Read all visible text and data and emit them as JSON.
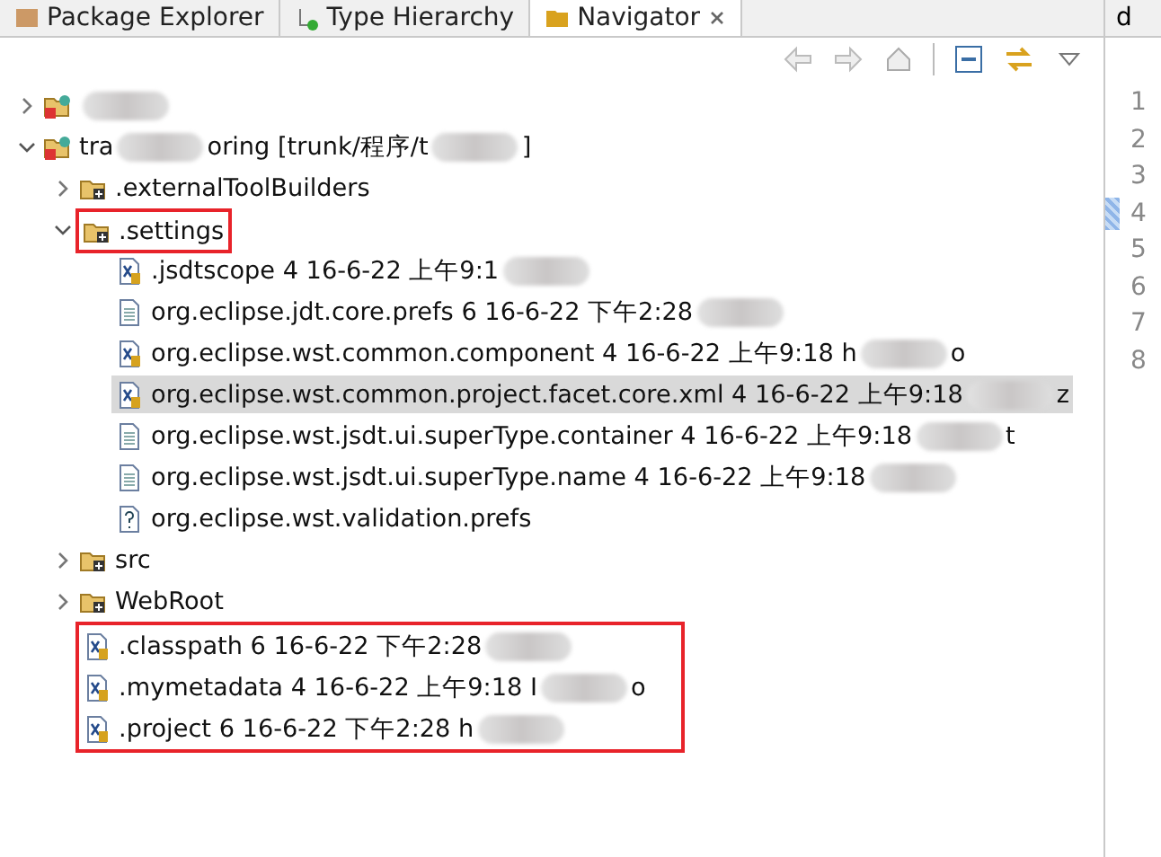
{
  "tabs": [
    {
      "label": "Package Explorer",
      "kind": "package",
      "selected": false
    },
    {
      "label": "Type Hierarchy",
      "kind": "hierarchy",
      "selected": false
    },
    {
      "label": "Navigator",
      "kind": "navigator",
      "selected": true
    }
  ],
  "tree": [
    {
      "kind": "project",
      "expanded": false,
      "selected": false,
      "highlighted": false,
      "segments": [
        {
          "kind": "blur"
        }
      ]
    },
    {
      "kind": "project",
      "expanded": true,
      "selected": false,
      "highlighted": false,
      "segments": [
        {
          "kind": "text",
          "text": "tra"
        },
        {
          "kind": "blur"
        },
        {
          "kind": "text",
          "text": "oring [trunk/程序/t"
        },
        {
          "kind": "blur"
        },
        {
          "kind": "text",
          "text": "]"
        }
      ],
      "children": [
        {
          "kind": "folder",
          "expanded": false,
          "selected": false,
          "highlighted": false,
          "segments": [
            {
              "kind": "text",
              "text": ".externalToolBuilders"
            }
          ]
        },
        {
          "kind": "folder",
          "expanded": true,
          "selected": false,
          "highlighted": true,
          "segments": [
            {
              "kind": "text",
              "text": ".settings"
            }
          ],
          "children": [
            {
              "kind": "xfile",
              "selected": false,
              "highlighted": false,
              "segments": [
                {
                  "kind": "text",
                  "text": ".jsdtscope 4  16-6-22 上午9:1"
                },
                {
                  "kind": "blur"
                }
              ]
            },
            {
              "kind": "textfile",
              "selected": false,
              "highlighted": false,
              "segments": [
                {
                  "kind": "text",
                  "text": "org.eclipse.jdt.core.prefs 6  16-6-22 下午2:28"
                },
                {
                  "kind": "blur"
                }
              ]
            },
            {
              "kind": "xfile",
              "selected": false,
              "highlighted": false,
              "segments": [
                {
                  "kind": "text",
                  "text": "org.eclipse.wst.common.component 4  16-6-22 上午9:18  h"
                },
                {
                  "kind": "blur"
                },
                {
                  "kind": "text",
                  "text": "o"
                }
              ]
            },
            {
              "kind": "xfile",
              "selected": true,
              "highlighted": false,
              "segments": [
                {
                  "kind": "text",
                  "text": "org.eclipse.wst.common.project.facet.core.xml 4  16-6-22 上午9:18"
                },
                {
                  "kind": "blur"
                },
                {
                  "kind": "text",
                  "text": "z"
                }
              ]
            },
            {
              "kind": "textfile",
              "selected": false,
              "highlighted": false,
              "segments": [
                {
                  "kind": "text",
                  "text": "org.eclipse.wst.jsdt.ui.superType.container 4  16-6-22 上午9:18"
                },
                {
                  "kind": "blur"
                },
                {
                  "kind": "text",
                  "text": "t"
                }
              ]
            },
            {
              "kind": "textfile",
              "selected": false,
              "highlighted": false,
              "segments": [
                {
                  "kind": "text",
                  "text": "org.eclipse.wst.jsdt.ui.superType.name 4  16-6-22 上午9:18"
                },
                {
                  "kind": "blur"
                }
              ]
            },
            {
              "kind": "unknownfile",
              "selected": false,
              "highlighted": false,
              "segments": [
                {
                  "kind": "text",
                  "text": "org.eclipse.wst.validation.prefs"
                }
              ]
            }
          ]
        },
        {
          "kind": "folder",
          "expanded": false,
          "selected": false,
          "highlighted": false,
          "segments": [
            {
              "kind": "text",
              "text": "src"
            }
          ]
        },
        {
          "kind": "folder",
          "expanded": false,
          "selected": false,
          "highlighted": false,
          "segments": [
            {
              "kind": "text",
              "text": "WebRoot"
            }
          ]
        },
        {
          "kind": "xfile",
          "selected": false,
          "highlighted": true,
          "segments": [
            {
              "kind": "text",
              "text": ".classpath 6  16-6-22 下午2:28"
            },
            {
              "kind": "blur"
            }
          ]
        },
        {
          "kind": "xfile",
          "selected": false,
          "highlighted": true,
          "segments": [
            {
              "kind": "text",
              "text": ".mymetadata 4  16-6-22 上午9:18  I"
            },
            {
              "kind": "blur"
            },
            {
              "kind": "text",
              "text": "o"
            }
          ]
        },
        {
          "kind": "xfile",
          "selected": false,
          "highlighted": true,
          "segments": [
            {
              "kind": "text",
              "text": ".project 6  16-6-22 下午2:28  h"
            },
            {
              "kind": "blur"
            }
          ]
        }
      ]
    }
  ],
  "editor": {
    "tab": "d",
    "lines": [
      {
        "number": "1",
        "marked": false
      },
      {
        "number": "2",
        "marked": false
      },
      {
        "number": "3",
        "marked": false
      },
      {
        "number": "4",
        "marked": true
      },
      {
        "number": "5",
        "marked": false
      },
      {
        "number": "6",
        "marked": false
      },
      {
        "number": "7",
        "marked": false
      },
      {
        "number": "8",
        "marked": false
      }
    ]
  }
}
